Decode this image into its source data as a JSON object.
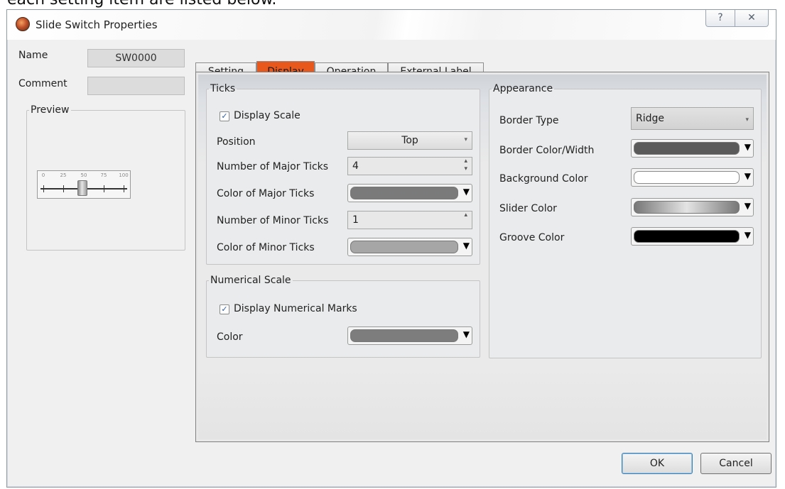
{
  "doc": {
    "cropped_text": "each setting item are listed below."
  },
  "window": {
    "title": "Slide Switch Properties",
    "help_glyph": "?",
    "close_glyph": "✕"
  },
  "left": {
    "name_label": "Name",
    "name_value": "SW0000",
    "comment_label": "Comment",
    "comment_value": "",
    "preview_label": "Preview",
    "preview_scale": [
      "0",
      "25",
      "50",
      "75",
      "100"
    ]
  },
  "tabs": [
    {
      "label": "Setting"
    },
    {
      "label": "Display"
    },
    {
      "label": "Operation"
    },
    {
      "label": "External Label"
    }
  ],
  "ticks": {
    "legend": "Ticks",
    "display_scale_label": "Display Scale",
    "display_scale_checked": true,
    "position_label": "Position",
    "position_value": "Top",
    "major_count_label": "Number of Major Ticks",
    "major_count_value": "4",
    "major_color_label": "Color of Major Ticks",
    "minor_count_label": "Number of Minor Ticks",
    "minor_count_value": "1",
    "minor_color_label": "Color of Minor Ticks"
  },
  "numerical": {
    "legend": "Numerical Scale",
    "display_marks_label": "Display Numerical Marks",
    "display_marks_checked": true,
    "color_label": "Color"
  },
  "appearance": {
    "legend": "Appearance",
    "border_type_label": "Border Type",
    "border_type_value": "Ridge",
    "border_color_label": "Border Color/Width",
    "background_color_label": "Background Color",
    "slider_color_label": "Slider Color",
    "groove_color_label": "Groove Color"
  },
  "colors": {
    "accent_tab": "#e8581d",
    "major_ticks": "#7a7a7a",
    "minor_ticks": "#a6a6a6",
    "numerical": "#7d7d7d",
    "border": "#5a5a5a",
    "background": "#ffffff",
    "groove": "#000000"
  },
  "buttons": {
    "ok": "OK",
    "cancel": "Cancel"
  }
}
